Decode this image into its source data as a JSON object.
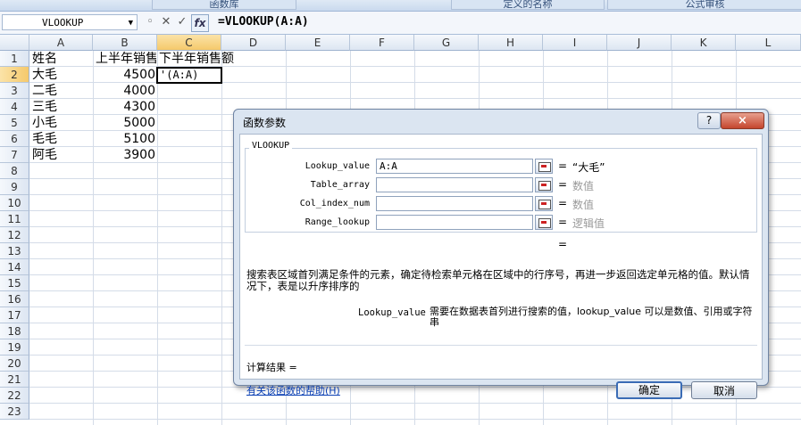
{
  "ribbon": {
    "groups": [
      "函数库",
      "定义的名称",
      "公式审核"
    ]
  },
  "formula_bar": {
    "name_box": "VLOOKUP",
    "formula": "=VLOOKUP(A:A)"
  },
  "columns": [
    "A",
    "B",
    "C",
    "D",
    "E",
    "F",
    "G",
    "H",
    "I",
    "J",
    "K",
    "L"
  ],
  "rows": [
    "1",
    "2",
    "3",
    "4",
    "5",
    "6",
    "7",
    "8",
    "9",
    "10",
    "11",
    "12",
    "13",
    "14",
    "15",
    "16",
    "17",
    "18",
    "19",
    "20",
    "21",
    "22",
    "23"
  ],
  "cells": {
    "a1": "姓名",
    "b1": "上半年销售",
    "c1": "下半年销售额",
    "a2": "大毛",
    "b2": "4500",
    "c2": "'(A:A)",
    "a3": "二毛",
    "b3": "4000",
    "a4": "三毛",
    "b4": "4300",
    "a5": "小毛",
    "b5": "5000",
    "a6": "毛毛",
    "b6": "5100",
    "a7": "阿毛",
    "b7": "3900"
  },
  "dialog": {
    "title": "函数参数",
    "help_button": "?",
    "close_button": "×",
    "function_name": "VLOOKUP",
    "args": [
      {
        "label": "Lookup_value",
        "value": "A:A",
        "result": "“大毛”"
      },
      {
        "label": "Table_array",
        "value": "",
        "result": "数值"
      },
      {
        "label": "Col_index_num",
        "value": "",
        "result": "数值"
      },
      {
        "label": "Range_lookup",
        "value": "",
        "result": "逻辑值"
      }
    ],
    "equals": "=",
    "result_equals": "=",
    "description": "搜索表区域首列满足条件的元素，确定待检索单元格在区域中的行序号，再进一步返回选定单元格的值。默认情况下，表是以升序排序的",
    "arg_desc_name": "Lookup_value",
    "arg_desc_text": "需要在数据表首列进行搜索的值，lookup_value 可以是数值、引用或字符串",
    "calc_result": "计算结果 =",
    "help_link": "有关该函数的帮助(H)",
    "ok": "确定",
    "cancel": "取消"
  },
  "colors": {
    "header_selected": "#f5c96b",
    "link": "#0a3fb3",
    "close": "#c4452d"
  }
}
